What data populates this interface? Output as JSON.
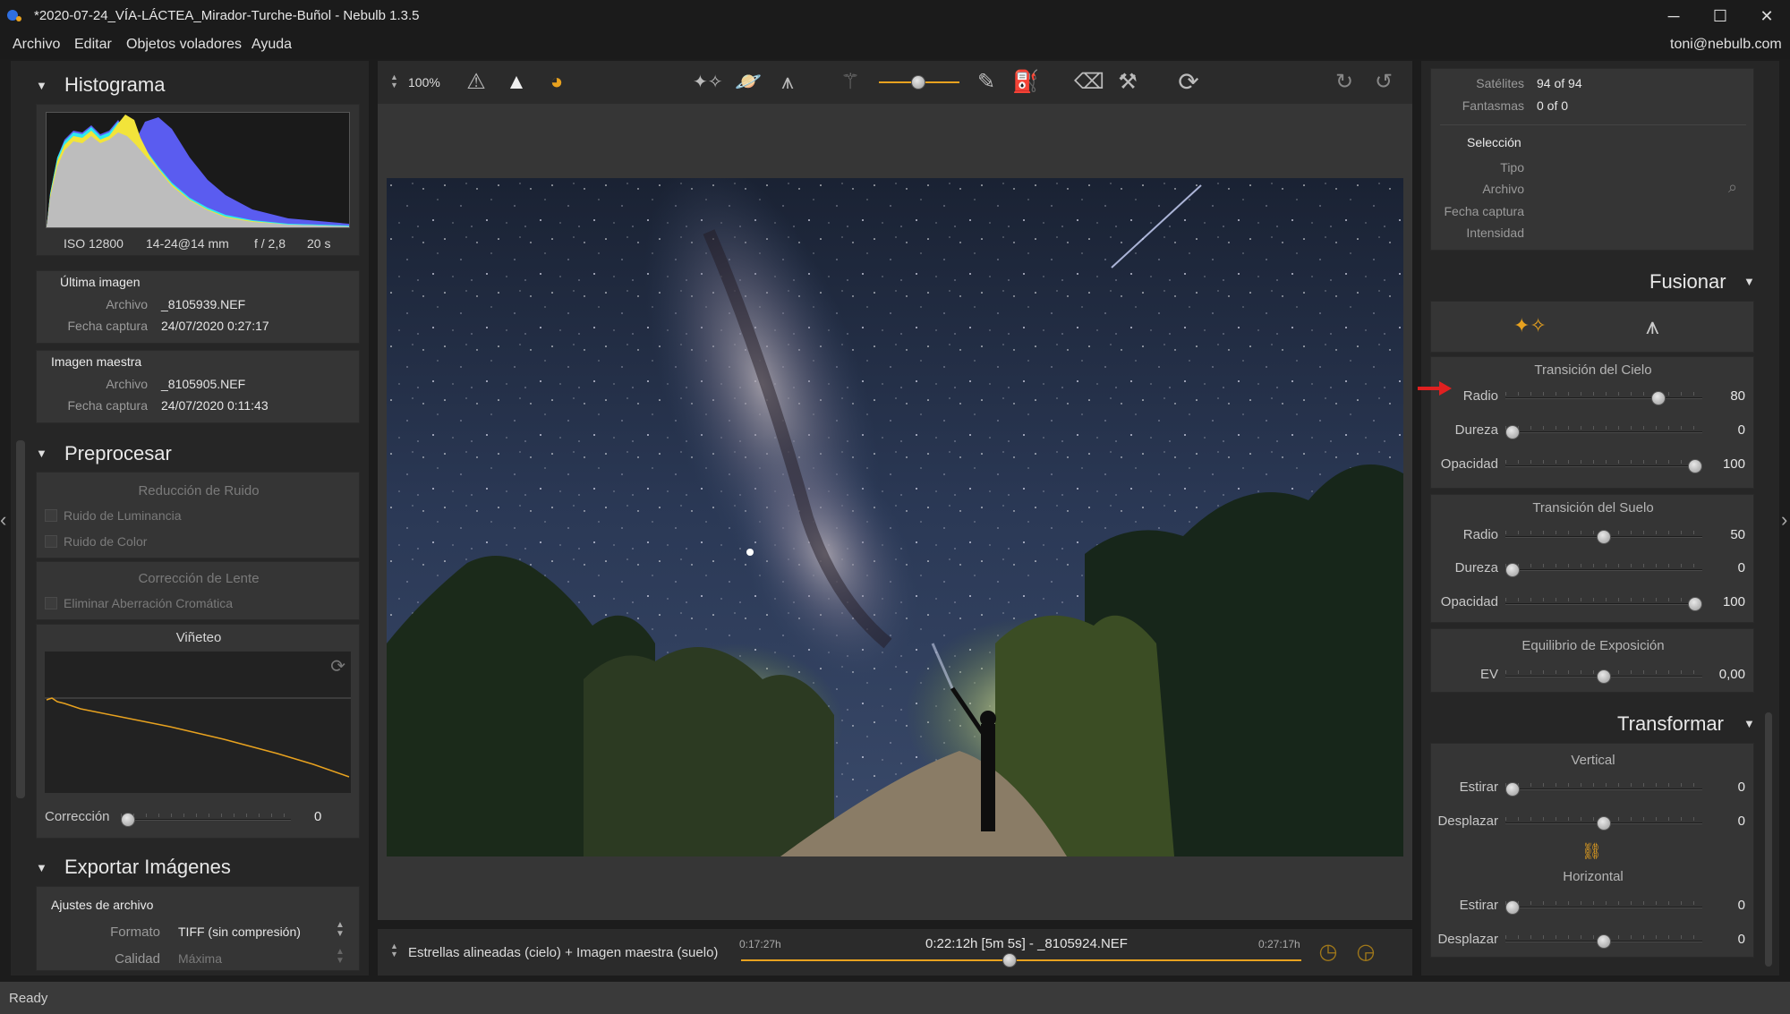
{
  "window": {
    "title": "*2020-07-24_VÍA-LÁCTEA_Mirador-Turche-Buñol - Nebulb 1.3.5",
    "minimize_glyph": "─",
    "maximize_glyph": "☐",
    "close_glyph": "✕"
  },
  "menu": {
    "items": [
      "Archivo",
      "Editar",
      "Objetos voladores",
      "Ayuda"
    ],
    "user": "toni@nebulb.com"
  },
  "left": {
    "histogram": {
      "title": "Histograma",
      "iso": "ISO 12800",
      "lens": "14-24@14 mm",
      "aperture": "f / 2,8",
      "exposure": "20 s"
    },
    "last_image": {
      "heading": "Última imagen",
      "file_label": "Archivo",
      "file_value": "_8105939.NEF",
      "date_label": "Fecha captura",
      "date_value": "24/07/2020 0:27:17"
    },
    "master_image": {
      "heading": "Imagen maestra",
      "file_label": "Archivo",
      "file_value": "_8105905.NEF",
      "date_label": "Fecha captura",
      "date_value": "24/07/2020 0:11:43"
    },
    "preprocess": {
      "title": "Preprocesar",
      "noise_heading": "Reducción de Ruido",
      "luminance": "Ruido de Luminancia",
      "color": "Ruido de Color",
      "lens_heading": "Corrección de Lente",
      "chromatic": "Eliminar Aberración Cromática",
      "vignette_heading": "Viñeteo",
      "correction_label": "Corrección",
      "correction_value": "0",
      "correction_level": 0
    },
    "export": {
      "title": "Exportar Imágenes",
      "file_settings": "Ajustes de archivo",
      "format_label": "Formato",
      "format_value": "TIFF (sin compresión)",
      "quality_label": "Calidad",
      "quality_value": "Máxima"
    }
  },
  "toolbar": {
    "zoom": "100%"
  },
  "bottom": {
    "mode": "Estrellas alineadas (cielo) + Imagen maestra (suelo)",
    "start_time": "0:17:27h",
    "current": "0:22:12h [5m 5s] - _8105924.NEF",
    "end_time": "0:27:17h",
    "timeline_position": 0.48
  },
  "right": {
    "satellites_label": "Satélites",
    "satellites_value": "94 of 94",
    "ghosts_label": "Fantasmas",
    "ghosts_value": "0 of 0",
    "selection_heading": "Selección",
    "type_label": "Tipo",
    "file_label": "Archivo",
    "date_label": "Fecha captura",
    "intensity_label": "Intensidad",
    "merge": {
      "title": "Fusionar",
      "sky_heading": "Transición del Cielo",
      "sky_radius_label": "Radio",
      "sky_radius_value": "80",
      "sky_radius_level": 0.8,
      "sky_hardness_label": "Dureza",
      "sky_hardness_value": "0",
      "sky_hardness_level": 0,
      "sky_opacity_label": "Opacidad",
      "sky_opacity_value": "100",
      "sky_opacity_level": 1,
      "ground_heading": "Transición del Suelo",
      "ground_radius_label": "Radio",
      "ground_radius_value": "50",
      "ground_radius_level": 0.5,
      "ground_hardness_label": "Dureza",
      "ground_hardness_value": "0",
      "ground_hardness_level": 0,
      "ground_opacity_label": "Opacidad",
      "ground_opacity_value": "100",
      "ground_opacity_level": 1,
      "exposure_heading": "Equilibrio de Exposición",
      "ev_label": "EV",
      "ev_value": "0,00",
      "ev_level": 0.5
    },
    "transform": {
      "title": "Transformar",
      "vertical_heading": "Vertical",
      "v_stretch_label": "Estirar",
      "v_stretch_value": "0",
      "v_stretch_level": 0,
      "v_shift_label": "Desplazar",
      "v_shift_value": "0",
      "v_shift_level": 0.5,
      "horizontal_heading": "Horizontal",
      "h_stretch_label": "Estirar",
      "h_stretch_value": "0",
      "h_stretch_level": 0,
      "h_shift_label": "Desplazar",
      "h_shift_value": "0",
      "h_shift_level": 0.5
    }
  },
  "status": {
    "text": "Ready"
  },
  "colors": {
    "accent": "#e8a21f",
    "hist_blue": "#5a5cf0",
    "hist_cyan": "#2ee8f0",
    "hist_yellow": "#f2e43a",
    "arrow_red": "#e02020"
  }
}
